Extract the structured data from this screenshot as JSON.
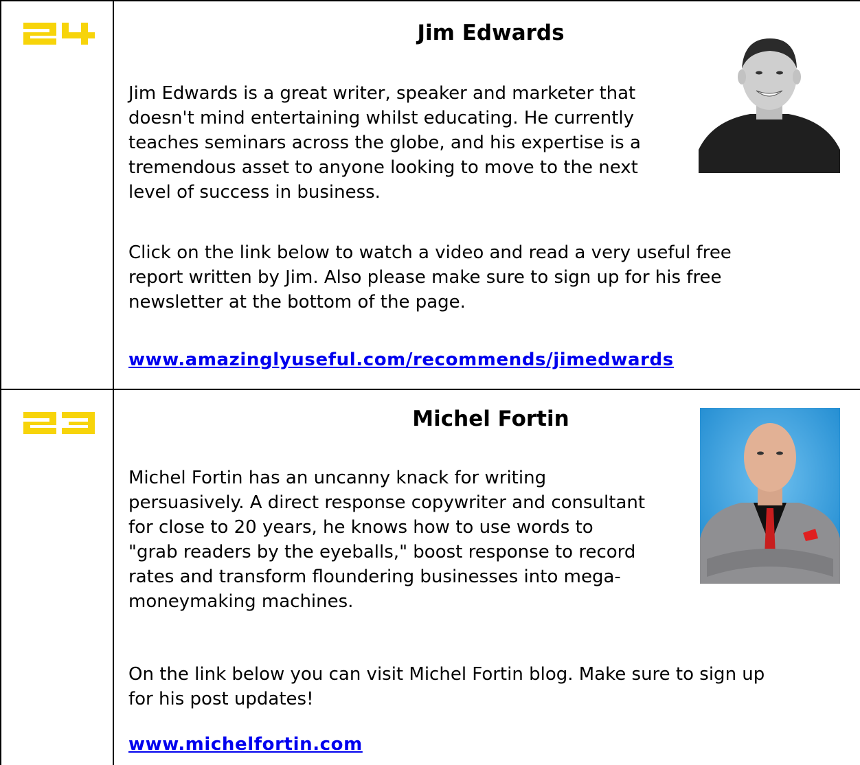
{
  "entries": [
    {
      "rank": "24",
      "name": "Jim Edwards",
      "bio_lines": [
        "Jim Edwards is a great writer, speaker and marketer that",
        "doesn't mind entertaining whilst educating. He currently",
        "teaches seminars across the globe, and his expertise is a",
        "tremendous asset to anyone looking to move to the next",
        "level of success in business."
      ],
      "cta_lines": [
        "Click on the link below to watch a video and read a very useful free",
        "report written by Jim. Also please make sure to sign up for his free",
        "newsletter at the bottom of the page."
      ],
      "link": "www.amazinglyuseful.com/recommends/jimedwards",
      "photo_icon": "portrait-photo"
    },
    {
      "rank": "23",
      "name": "Michel Fortin",
      "bio_lines": [
        "Michel Fortin has an uncanny knack for writing",
        "persuasively. A direct response copywriter and consultant",
        "for close to 20 years, he knows how to use words to",
        "\"grab readers by the eyeballs,\" boost response to record",
        "rates and transform floundering businesses into mega-",
        "moneymaking machines."
      ],
      "cta_lines": [
        "On the link below you can visit Michel Fortin blog. Make sure to sign up",
        "for his post updates!"
      ],
      "link": "www.michelfortin.com",
      "photo_icon": "portrait-photo"
    }
  ],
  "colors": {
    "rank_number": "#f7d40a",
    "link": "#0000ee",
    "border": "#000000"
  }
}
